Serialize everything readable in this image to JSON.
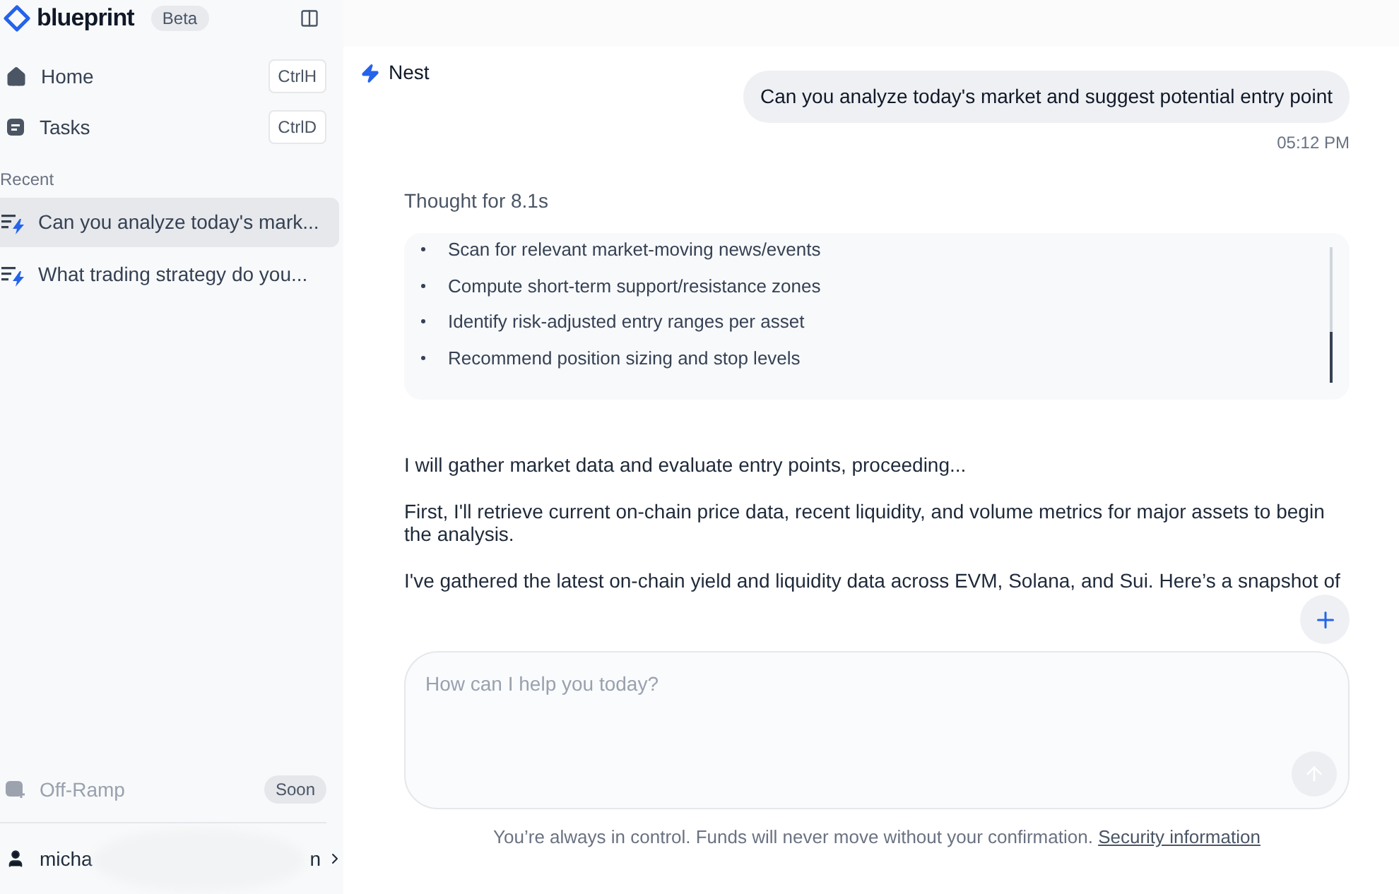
{
  "sidebar": {
    "brand": "blueprint",
    "badge": "Beta",
    "nav": [
      {
        "label": "Home",
        "shortcut": "CtrlH",
        "kind": "home"
      },
      {
        "label": "Tasks",
        "shortcut": "CtrlD",
        "kind": "tasks"
      }
    ],
    "recent_heading": "Recent",
    "recent": [
      {
        "label": "Can you analyze today's mark...",
        "selected": true
      },
      {
        "label": "What trading strategy do you...",
        "selected": false
      }
    ],
    "off_ramp": {
      "label": "Off-Ramp",
      "badge": "Soon",
      "disabled": true
    },
    "user": {
      "name": "micha",
      "name_tail": "n"
    }
  },
  "chat": {
    "agent": "Nest",
    "user_message": {
      "text": "Can you analyze today's market and suggest potential entry point",
      "time": "05:12 PM"
    },
    "thought": {
      "label": "Thought for 8.1s",
      "steps": [
        "Scan for relevant market-moving news/events",
        "Compute short-term support/resistance zones",
        "Identify risk-adjusted entry ranges per asset",
        "Recommend position sizing and stop levels"
      ]
    },
    "paragraphs": [
      "I will gather market data and evaluate entry points, proceeding...",
      "First, I'll retrieve current on-chain price data, recent liquidity, and volume metrics for major assets to begin the analysis.",
      "I've gathered the latest on-chain yield and liquidity data across EVM, Solana, and Sui. Here’s a snapshot of"
    ]
  },
  "composer": {
    "placeholder": "How can I help you today?"
  },
  "footer": {
    "text": "You’re always in control. Funds will never move without your confirmation.",
    "link": "Security information"
  }
}
